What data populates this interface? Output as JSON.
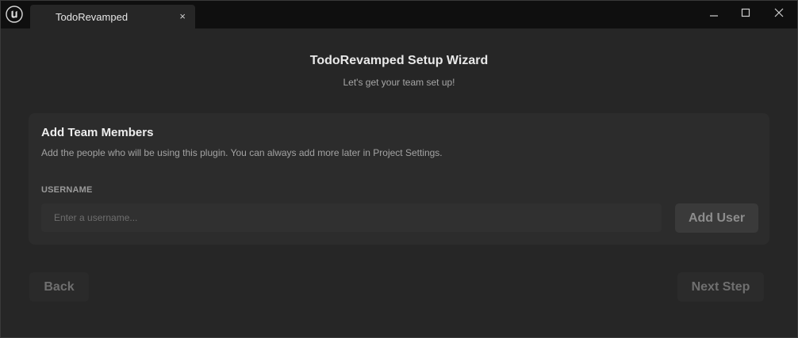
{
  "window": {
    "tab_title": "TodoRevamped",
    "tab_close_glyph": "×",
    "icons": {
      "app": "unreal-engine-logo-icon",
      "minimize": "minimize-icon",
      "maximize": "maximize-icon",
      "close": "close-icon"
    }
  },
  "header": {
    "title": "TodoRevamped Setup Wizard",
    "subtitle": "Let's get your team set up!"
  },
  "card": {
    "title": "Add Team Members",
    "description": "Add the people who will be using this plugin. You can always add more later in Project Settings.",
    "field_label": "USERNAME",
    "input_value": "",
    "input_placeholder": "Enter a username...",
    "add_button_label": "Add User"
  },
  "footer": {
    "back_label": "Back",
    "next_label": "Next Step"
  },
  "colors": {
    "background": "#262626",
    "titlebar": "#0f0f0f",
    "card": "#2c2c2c",
    "text_primary": "#e8e8e8",
    "text_secondary": "#a6a6a6"
  }
}
